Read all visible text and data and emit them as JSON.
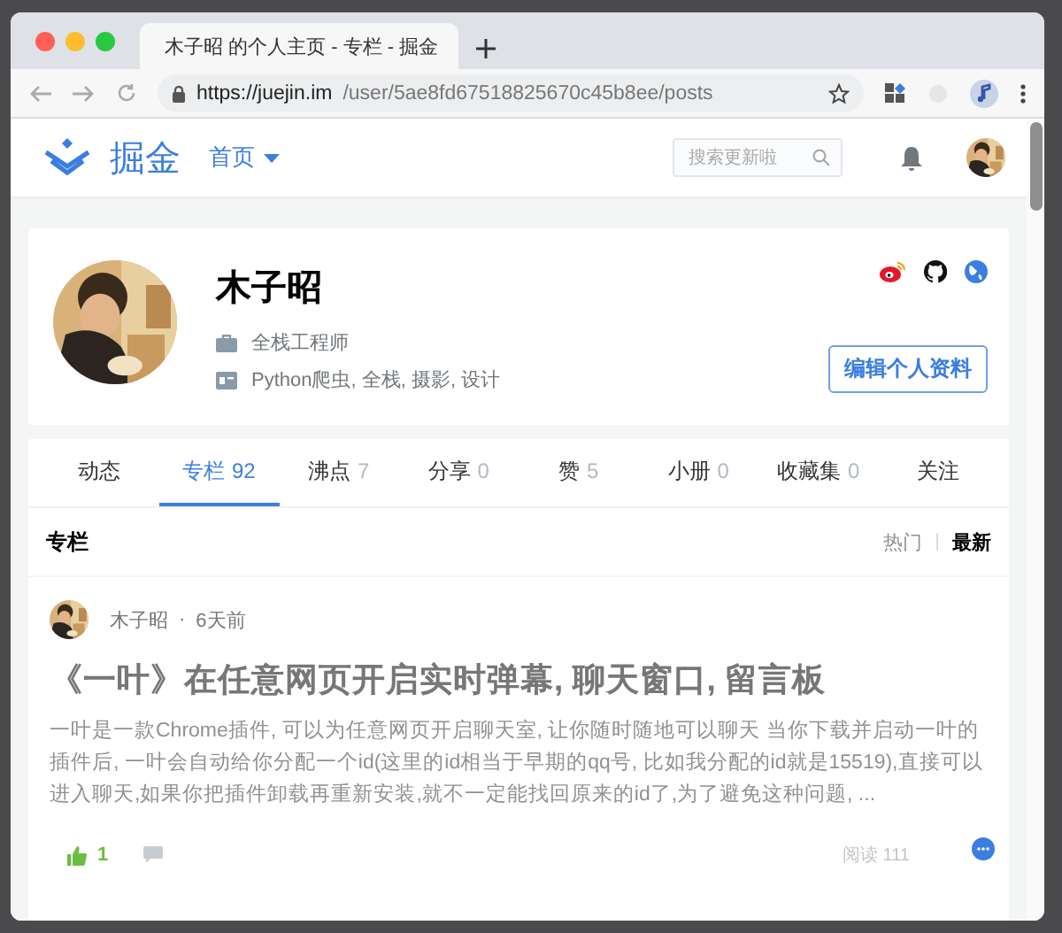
{
  "browser": {
    "tab_title": "木子昭 的个人主页 - 专栏 - 掘金",
    "url_host": "https://juejin.im",
    "url_path": "/user/5ae8fd67518825670c45b8ee/posts"
  },
  "site_header": {
    "logo_text": "掘金",
    "nav": "首页",
    "search_placeholder": "搜索更新啦"
  },
  "profile": {
    "name": "木子昭",
    "job": "全栈工程师",
    "tags": "Python爬虫, 全栈, 摄影, 设计",
    "edit_button": "编辑个人资料"
  },
  "tabs": [
    {
      "label": "动态",
      "selected": false
    },
    {
      "label": "专栏",
      "count": "92",
      "selected": true
    },
    {
      "label": "沸点",
      "count": "7",
      "selected": false
    },
    {
      "label": "分享",
      "count": "0",
      "selected": false
    },
    {
      "label": "赞",
      "count": "5",
      "selected": false
    },
    {
      "label": "小册",
      "count": "0",
      "selected": false
    },
    {
      "label": "收藏集",
      "count": "0",
      "selected": false
    },
    {
      "label": "关注",
      "selected": false
    }
  ],
  "section": {
    "title": "专栏",
    "sorts": [
      {
        "label": "热门",
        "selected": false
      },
      {
        "label": "最新",
        "selected": true
      }
    ]
  },
  "post": {
    "author": "木子昭",
    "separator": "·",
    "time": "6天前",
    "title": "《一叶》在任意网页开启实时弹幕, 聊天窗口, 留言板",
    "excerpt": "一叶是一款Chrome插件, 可以为任意网页开启聊天室, 让你随时随地可以聊天 当你下载并启动一叶的插件后, 一叶会自动给你分配一个id(这里的id相当于早期的qq号, 比如我分配的id就是15519),直接可以进入聊天,如果你把插件卸载再重新安装,就不一定能找回原来的id了,为了避免这种问题, ...",
    "likes": "1",
    "reads": "阅读 111"
  }
}
